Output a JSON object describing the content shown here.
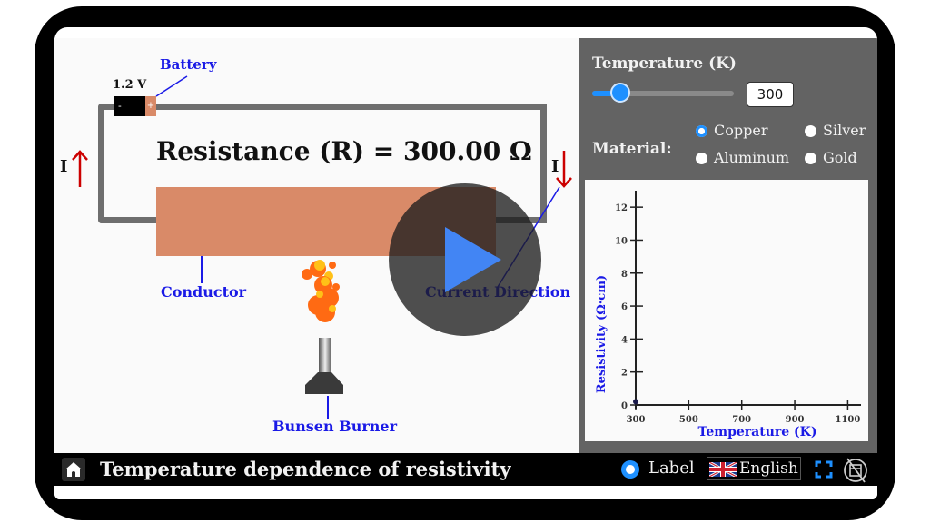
{
  "simulation": {
    "battery_voltage": "1.2 V",
    "battery_minus": "-",
    "battery_plus": "+",
    "resistance_label": "Resistance (R) = 300.00 Ω",
    "current_symbol_left": "I",
    "current_symbol_right": "I",
    "labels": {
      "battery": "Battery",
      "conductor": "Conductor",
      "bunsen_burner": "Bunsen Burner",
      "current_direction": "Current Direction"
    },
    "colors": {
      "conductor": "#d98a68",
      "wire": "#6e6e6e",
      "label_blue": "#1a1ae6",
      "arrow_red": "#cc0000"
    }
  },
  "controls": {
    "temperature_label": "Temperature (K)",
    "temperature_value": "300",
    "temperature_slider_fraction": 0.2,
    "material_label": "Material:",
    "materials": [
      {
        "label": "Copper",
        "selected": true
      },
      {
        "label": "Silver",
        "selected": false
      },
      {
        "label": "Aluminum",
        "selected": false
      },
      {
        "label": "Gold",
        "selected": false
      }
    ],
    "accent": "#1e90ff"
  },
  "chart_data": {
    "type": "scatter",
    "title": "",
    "xlabel": "Temperature (K)",
    "ylabel": "Resistivity (Ω·cm)",
    "x_ticks": [
      "300",
      "500",
      "700",
      "900",
      "1100"
    ],
    "y_ticks": [
      "0",
      "2",
      "4",
      "6",
      "8",
      "10",
      "12"
    ],
    "xlim": [
      300,
      1150
    ],
    "ylim": [
      0,
      13
    ],
    "grid": false,
    "series": [
      {
        "name": "Copper",
        "points": [
          {
            "x": 300,
            "y": 0.2
          }
        ]
      }
    ]
  },
  "bottom_bar": {
    "title": "Temperature dependence of resistivity",
    "label_toggle": "Label",
    "language": "English"
  },
  "overlay": {
    "play_color": "#4285f4"
  }
}
